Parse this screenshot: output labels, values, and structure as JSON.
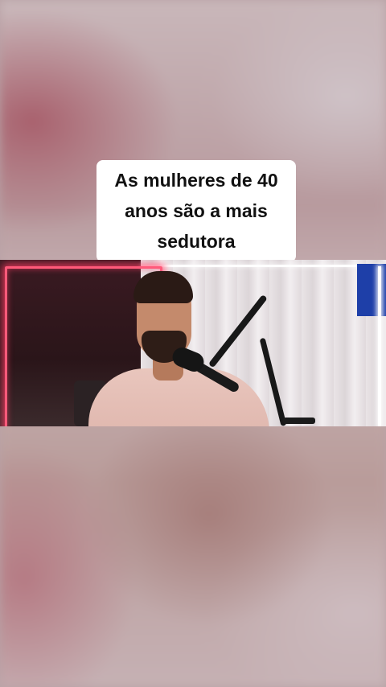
{
  "caption": {
    "lines": [
      "As mulheres de 40",
      "anos são a mais",
      "sedutora"
    ]
  },
  "colors": {
    "caption_bg": "#ffffff",
    "caption_text": "#111111",
    "neon": "#ff5a7a",
    "backdrop": "#b9a3a6"
  }
}
